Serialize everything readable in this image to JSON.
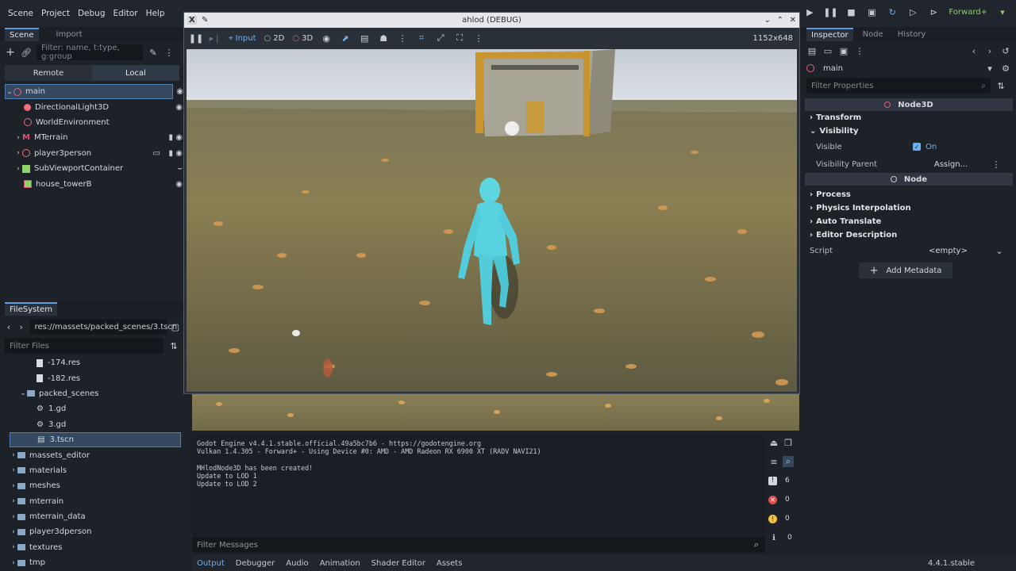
{
  "menu": [
    "Scene",
    "Project",
    "Debug",
    "Editor",
    "Help"
  ],
  "renderer": "Forward+",
  "scene_dock": {
    "tabs": [
      "Scene",
      "Import"
    ],
    "filter_placeholder": "Filter: name, t:type, g:group",
    "remote_label": "Remote",
    "local_label": "Local",
    "nodes": [
      {
        "name": "main",
        "color": "#e0607a",
        "selected": true
      },
      {
        "name": "DirectionalLight3D",
        "color": "#f26d7a"
      },
      {
        "name": "WorldEnvironment",
        "color": "#e06b83"
      },
      {
        "name": "MTerrain",
        "color": "#e05070"
      },
      {
        "name": "player3person",
        "color": "#f07080"
      },
      {
        "name": "SubViewportContainer",
        "color": "#8fd46b"
      },
      {
        "name": "house_towerB",
        "color": "#e05070"
      }
    ]
  },
  "filesystem": {
    "tab": "FileSystem",
    "path": "res://massets/packed_scenes/3.tscn",
    "filter_placeholder": "Filter Files",
    "items": [
      {
        "name": "-174.res",
        "kind": "file",
        "indent": 2
      },
      {
        "name": "-182.res",
        "kind": "file",
        "indent": 2
      },
      {
        "name": "packed_scenes",
        "kind": "folder",
        "indent": 1
      },
      {
        "name": "1.gd",
        "kind": "gear",
        "indent": 2
      },
      {
        "name": "3.gd",
        "kind": "gear",
        "indent": 2
      },
      {
        "name": "3.tscn",
        "kind": "scene",
        "indent": 2,
        "selected": true
      },
      {
        "name": "massets_editor",
        "kind": "folder",
        "indent": 0
      },
      {
        "name": "materials",
        "kind": "folder",
        "indent": 0
      },
      {
        "name": "meshes",
        "kind": "folder",
        "indent": 0
      },
      {
        "name": "mterrain",
        "kind": "folder",
        "indent": 0
      },
      {
        "name": "mterrain_data",
        "kind": "folder",
        "indent": 0
      },
      {
        "name": "player3dperson",
        "kind": "folder",
        "indent": 0
      },
      {
        "name": "textures",
        "kind": "folder",
        "indent": 0
      },
      {
        "name": "tmp",
        "kind": "folder",
        "indent": 0
      }
    ]
  },
  "game_window": {
    "title": "ahlod (DEBUG)",
    "input_label": "Input",
    "mode_2d": "2D",
    "mode_3d": "3D",
    "resolution": "1152x648"
  },
  "output": {
    "lines": [
      "Godot Engine v4.4.1.stable.official.49a5bc7b6 - https://godotengine.org",
      "Vulkan 1.4.305 - Forward+ - Using Device #0: AMD - AMD Radeon RX 6900 XT (RADV NAVI21)",
      "",
      "MHlodNode3D has been created!",
      "Update to LOD 1",
      "Update to LOD 2"
    ],
    "filter_placeholder": "Filter Messages",
    "counts": {
      "messages": "6",
      "errors": "0",
      "warnings": "0",
      "info": "0"
    }
  },
  "bottom_tabs": [
    "Output",
    "Debugger",
    "Audio",
    "Animation",
    "Shader Editor",
    "Assets"
  ],
  "version": "4.4.1.stable",
  "inspector": {
    "tabs": [
      "Inspector",
      "Node",
      "History"
    ],
    "object": "main",
    "filter_placeholder": "Filter Properties",
    "class_header": "Node3D",
    "sections_top": [
      "Transform",
      "Visibility"
    ],
    "visible_label": "Visible",
    "visible_value": "On",
    "visibility_parent_label": "Visibility Parent",
    "assign_label": "Assign...",
    "node_header": "Node",
    "sections_node": [
      "Process",
      "Physics Interpolation",
      "Auto Translate",
      "Editor Description"
    ],
    "script_label": "Script",
    "script_value": "<empty>",
    "add_metadata": "Add Metadata"
  }
}
